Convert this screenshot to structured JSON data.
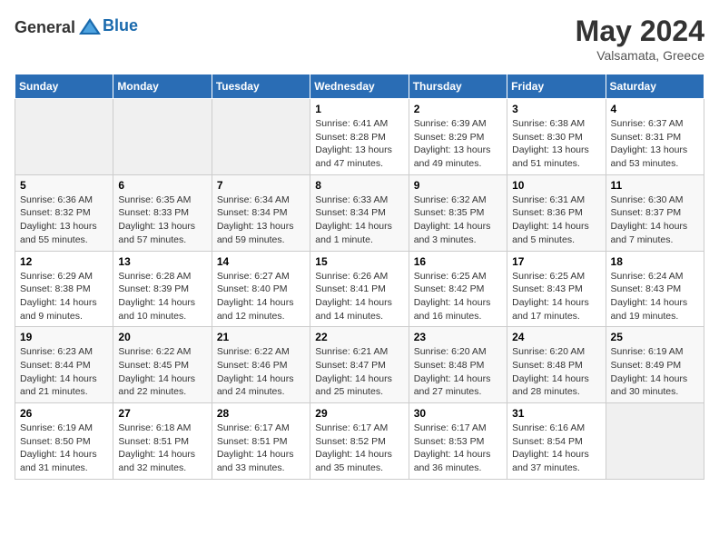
{
  "header": {
    "logo_general": "General",
    "logo_blue": "Blue",
    "title": "May 2024",
    "subtitle": "Valsamata, Greece"
  },
  "days_of_week": [
    "Sunday",
    "Monday",
    "Tuesday",
    "Wednesday",
    "Thursday",
    "Friday",
    "Saturday"
  ],
  "weeks": [
    {
      "days": [
        {
          "number": "",
          "info": "",
          "empty": true
        },
        {
          "number": "",
          "info": "",
          "empty": true
        },
        {
          "number": "",
          "info": "",
          "empty": true
        },
        {
          "number": "1",
          "info": "Sunrise: 6:41 AM\nSunset: 8:28 PM\nDaylight: 13 hours\nand 47 minutes."
        },
        {
          "number": "2",
          "info": "Sunrise: 6:39 AM\nSunset: 8:29 PM\nDaylight: 13 hours\nand 49 minutes."
        },
        {
          "number": "3",
          "info": "Sunrise: 6:38 AM\nSunset: 8:30 PM\nDaylight: 13 hours\nand 51 minutes."
        },
        {
          "number": "4",
          "info": "Sunrise: 6:37 AM\nSunset: 8:31 PM\nDaylight: 13 hours\nand 53 minutes."
        }
      ]
    },
    {
      "days": [
        {
          "number": "5",
          "info": "Sunrise: 6:36 AM\nSunset: 8:32 PM\nDaylight: 13 hours\nand 55 minutes."
        },
        {
          "number": "6",
          "info": "Sunrise: 6:35 AM\nSunset: 8:33 PM\nDaylight: 13 hours\nand 57 minutes."
        },
        {
          "number": "7",
          "info": "Sunrise: 6:34 AM\nSunset: 8:34 PM\nDaylight: 13 hours\nand 59 minutes."
        },
        {
          "number": "8",
          "info": "Sunrise: 6:33 AM\nSunset: 8:34 PM\nDaylight: 14 hours\nand 1 minute."
        },
        {
          "number": "9",
          "info": "Sunrise: 6:32 AM\nSunset: 8:35 PM\nDaylight: 14 hours\nand 3 minutes."
        },
        {
          "number": "10",
          "info": "Sunrise: 6:31 AM\nSunset: 8:36 PM\nDaylight: 14 hours\nand 5 minutes."
        },
        {
          "number": "11",
          "info": "Sunrise: 6:30 AM\nSunset: 8:37 PM\nDaylight: 14 hours\nand 7 minutes."
        }
      ]
    },
    {
      "days": [
        {
          "number": "12",
          "info": "Sunrise: 6:29 AM\nSunset: 8:38 PM\nDaylight: 14 hours\nand 9 minutes."
        },
        {
          "number": "13",
          "info": "Sunrise: 6:28 AM\nSunset: 8:39 PM\nDaylight: 14 hours\nand 10 minutes."
        },
        {
          "number": "14",
          "info": "Sunrise: 6:27 AM\nSunset: 8:40 PM\nDaylight: 14 hours\nand 12 minutes."
        },
        {
          "number": "15",
          "info": "Sunrise: 6:26 AM\nSunset: 8:41 PM\nDaylight: 14 hours\nand 14 minutes."
        },
        {
          "number": "16",
          "info": "Sunrise: 6:25 AM\nSunset: 8:42 PM\nDaylight: 14 hours\nand 16 minutes."
        },
        {
          "number": "17",
          "info": "Sunrise: 6:25 AM\nSunset: 8:43 PM\nDaylight: 14 hours\nand 17 minutes."
        },
        {
          "number": "18",
          "info": "Sunrise: 6:24 AM\nSunset: 8:43 PM\nDaylight: 14 hours\nand 19 minutes."
        }
      ]
    },
    {
      "days": [
        {
          "number": "19",
          "info": "Sunrise: 6:23 AM\nSunset: 8:44 PM\nDaylight: 14 hours\nand 21 minutes."
        },
        {
          "number": "20",
          "info": "Sunrise: 6:22 AM\nSunset: 8:45 PM\nDaylight: 14 hours\nand 22 minutes."
        },
        {
          "number": "21",
          "info": "Sunrise: 6:22 AM\nSunset: 8:46 PM\nDaylight: 14 hours\nand 24 minutes."
        },
        {
          "number": "22",
          "info": "Sunrise: 6:21 AM\nSunset: 8:47 PM\nDaylight: 14 hours\nand 25 minutes."
        },
        {
          "number": "23",
          "info": "Sunrise: 6:20 AM\nSunset: 8:48 PM\nDaylight: 14 hours\nand 27 minutes."
        },
        {
          "number": "24",
          "info": "Sunrise: 6:20 AM\nSunset: 8:48 PM\nDaylight: 14 hours\nand 28 minutes."
        },
        {
          "number": "25",
          "info": "Sunrise: 6:19 AM\nSunset: 8:49 PM\nDaylight: 14 hours\nand 30 minutes."
        }
      ]
    },
    {
      "days": [
        {
          "number": "26",
          "info": "Sunrise: 6:19 AM\nSunset: 8:50 PM\nDaylight: 14 hours\nand 31 minutes."
        },
        {
          "number": "27",
          "info": "Sunrise: 6:18 AM\nSunset: 8:51 PM\nDaylight: 14 hours\nand 32 minutes."
        },
        {
          "number": "28",
          "info": "Sunrise: 6:17 AM\nSunset: 8:51 PM\nDaylight: 14 hours\nand 33 minutes."
        },
        {
          "number": "29",
          "info": "Sunrise: 6:17 AM\nSunset: 8:52 PM\nDaylight: 14 hours\nand 35 minutes."
        },
        {
          "number": "30",
          "info": "Sunrise: 6:17 AM\nSunset: 8:53 PM\nDaylight: 14 hours\nand 36 minutes."
        },
        {
          "number": "31",
          "info": "Sunrise: 6:16 AM\nSunset: 8:54 PM\nDaylight: 14 hours\nand 37 minutes."
        },
        {
          "number": "",
          "info": "",
          "empty": true
        }
      ]
    }
  ]
}
